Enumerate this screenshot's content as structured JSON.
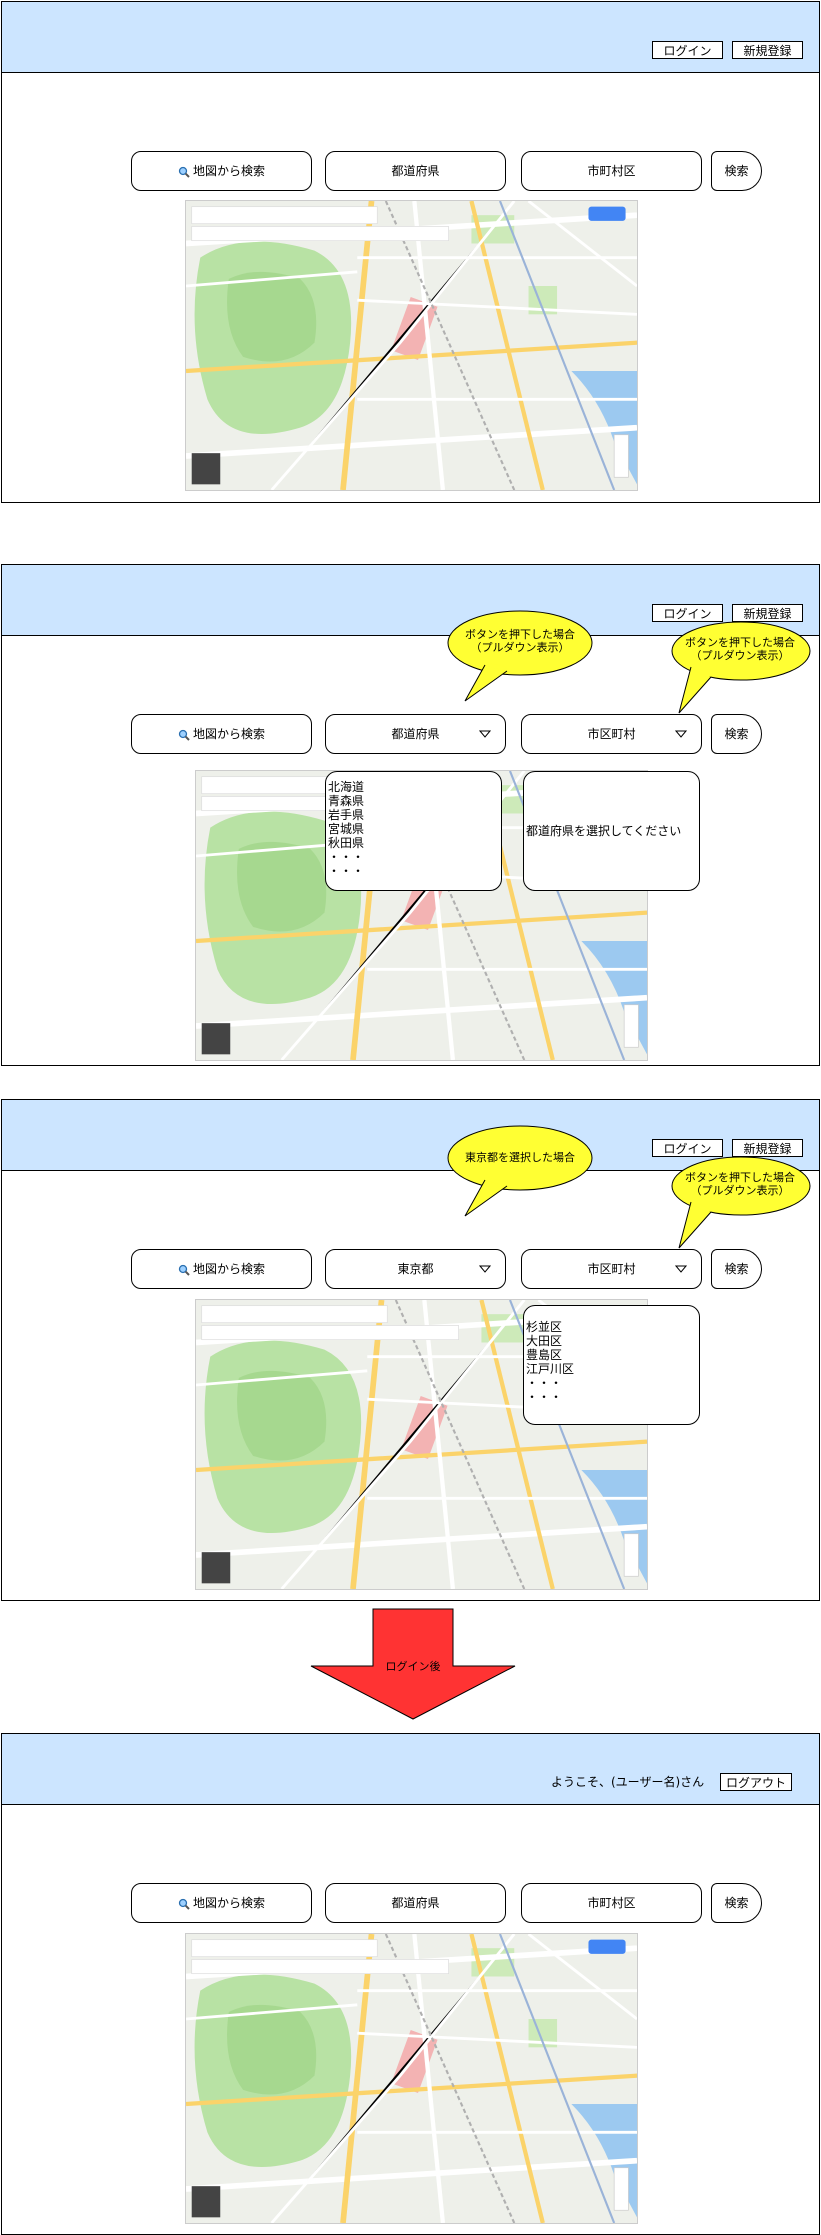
{
  "header": {
    "login_label": "ログイン",
    "register_label": "新規登録",
    "welcome_text": "ようこそ、(ユーザー名)さん",
    "logout_label": "ログアウト"
  },
  "search_row": {
    "map_search_label": "地図から検索",
    "prefecture_label": "都道府県",
    "city_label": "市町村区",
    "city_label_alt": "市区町村",
    "search_label": "検索",
    "selected_prefecture": "東京都"
  },
  "dropdowns": {
    "prefectures": [
      "北海道",
      "青森県",
      "岩手県",
      "宮城県",
      "秋田県",
      "・・・",
      "・・・"
    ],
    "city_prompt": "都道府県を選択してください",
    "tokyo_cities": [
      "杉並区",
      "大田区",
      "豊島区",
      "江戸川区",
      "・・・",
      "・・・"
    ]
  },
  "callouts": {
    "press_button": "ボタンを押下した場合\n（プルダウン表示）",
    "tokyo_selected": "東京都を選択した場合"
  },
  "flow": {
    "after_login": "ログイン後"
  },
  "colors": {
    "header_bg": "#cce5ff",
    "callout_fill": "#ffff33",
    "arrow_fill": "#ff3333"
  }
}
